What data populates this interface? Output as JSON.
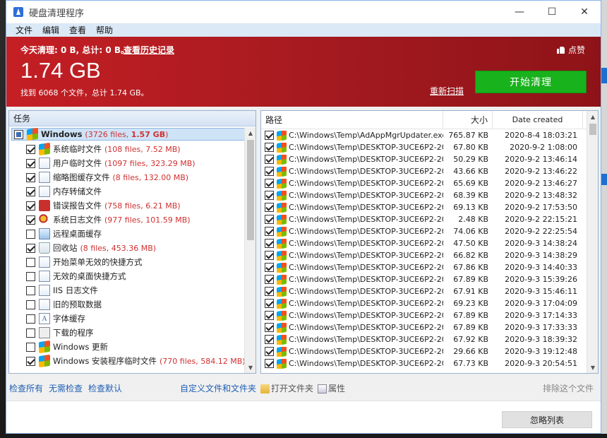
{
  "window": {
    "title": "硬盘清理程序",
    "controls": [
      "—",
      "☐",
      "✕"
    ]
  },
  "menu": [
    "文件",
    "编辑",
    "查看",
    "帮助"
  ],
  "header": {
    "today_summary": "今天清理: 0 B, 总计: 0 B。",
    "history_link": "查看历史记录",
    "like_label": "点赞",
    "total_size": "1.74 GB",
    "found_text": "找到 6068 个文件，总计 1.74 GB。",
    "rescan_link": "重新扫描",
    "start_button": "开始清理"
  },
  "tasks": {
    "header": "任务",
    "root": {
      "label": "Windows",
      "count": "3726 files",
      "size": "1.57 GB"
    },
    "items": [
      {
        "label": "系统临时文件",
        "stats": "(108 files, 7.52 MB)",
        "checked": true,
        "icon": "windows-icon"
      },
      {
        "label": "用户临时文件",
        "stats": "(1097 files, 323.29 MB)",
        "checked": true,
        "icon": "document-icon"
      },
      {
        "label": "缩略图缓存文件",
        "stats": "(8 files, 132.00 MB)",
        "checked": true,
        "icon": "document-icon"
      },
      {
        "label": "内存转储文件",
        "stats": "",
        "checked": true,
        "icon": "document-icon"
      },
      {
        "label": "错误报告文件",
        "stats": "(758 files, 6.21 MB)",
        "checked": true,
        "icon": "error-report-icon"
      },
      {
        "label": "系统日志文件",
        "stats": "(977 files, 101.59 MB)",
        "checked": true,
        "icon": "tools-icon"
      },
      {
        "label": "远程桌面缓存",
        "stats": "",
        "checked": false,
        "icon": "remote-desktop-icon"
      },
      {
        "label": "回收站",
        "stats": "(8 files, 453.36 MB)",
        "checked": true,
        "icon": "recycle-bin-icon"
      },
      {
        "label": "开始菜单无效的快捷方式",
        "stats": "",
        "checked": false,
        "icon": "shortcut-icon"
      },
      {
        "label": "无效的桌面快捷方式",
        "stats": "",
        "checked": false,
        "icon": "shortcut-icon"
      },
      {
        "label": "IIS 日志文件",
        "stats": "",
        "checked": false,
        "icon": "document-icon"
      },
      {
        "label": "旧的预取数据",
        "stats": "",
        "checked": false,
        "icon": "document-icon"
      },
      {
        "label": "字体缓存",
        "stats": "",
        "checked": false,
        "icon": "font-icon"
      },
      {
        "label": "下载的程序",
        "stats": "",
        "checked": false,
        "icon": "box-icon"
      },
      {
        "label": "Windows 更新",
        "stats": "",
        "checked": false,
        "icon": "windows-icon"
      },
      {
        "label": "Windows 安装程序临时文件",
        "stats": "(770 files, 584.12 MB)",
        "checked": true,
        "icon": "windows-icon"
      }
    ]
  },
  "files": {
    "columns": {
      "path": "路径",
      "size": "大小",
      "date": "Date created"
    },
    "rows": [
      {
        "path": "C:\\Windows\\Temp\\AdAppMgrUpdater.exe",
        "size": "765.87 KB",
        "date": "2020-8-4 18:03:21"
      },
      {
        "path": "C:\\Windows\\Temp\\DESKTOP-3UCE6P2-20...",
        "size": "67.80 KB",
        "date": "2020-9-2 1:08:00"
      },
      {
        "path": "C:\\Windows\\Temp\\DESKTOP-3UCE6P2-20...",
        "size": "50.29 KB",
        "date": "2020-9-2 13:46:14"
      },
      {
        "path": "C:\\Windows\\Temp\\DESKTOP-3UCE6P2-20...",
        "size": "43.66 KB",
        "date": "2020-9-2 13:46:22"
      },
      {
        "path": "C:\\Windows\\Temp\\DESKTOP-3UCE6P2-20...",
        "size": "65.69 KB",
        "date": "2020-9-2 13:46:27"
      },
      {
        "path": "C:\\Windows\\Temp\\DESKTOP-3UCE6P2-20...",
        "size": "68.39 KB",
        "date": "2020-9-2 13:48:32"
      },
      {
        "path": "C:\\Windows\\Temp\\DESKTOP-3UCE6P2-20...",
        "size": "69.13 KB",
        "date": "2020-9-2 17:53:50"
      },
      {
        "path": "C:\\Windows\\Temp\\DESKTOP-3UCE6P2-20...",
        "size": "2.48 KB",
        "date": "2020-9-2 22:15:21"
      },
      {
        "path": "C:\\Windows\\Temp\\DESKTOP-3UCE6P2-20...",
        "size": "74.06 KB",
        "date": "2020-9-2 22:25:54"
      },
      {
        "path": "C:\\Windows\\Temp\\DESKTOP-3UCE6P2-20...",
        "size": "47.50 KB",
        "date": "2020-9-3 14:38:24"
      },
      {
        "path": "C:\\Windows\\Temp\\DESKTOP-3UCE6P2-20...",
        "size": "66.82 KB",
        "date": "2020-9-3 14:38:29"
      },
      {
        "path": "C:\\Windows\\Temp\\DESKTOP-3UCE6P2-20...",
        "size": "67.86 KB",
        "date": "2020-9-3 14:40:33"
      },
      {
        "path": "C:\\Windows\\Temp\\DESKTOP-3UCE6P2-20...",
        "size": "67.89 KB",
        "date": "2020-9-3 15:39:26"
      },
      {
        "path": "C:\\Windows\\Temp\\DESKTOP-3UCE6P2-20...",
        "size": "67.91 KB",
        "date": "2020-9-3 15:46:11"
      },
      {
        "path": "C:\\Windows\\Temp\\DESKTOP-3UCE6P2-20...",
        "size": "69.23 KB",
        "date": "2020-9-3 17:04:09"
      },
      {
        "path": "C:\\Windows\\Temp\\DESKTOP-3UCE6P2-20...",
        "size": "67.89 KB",
        "date": "2020-9-3 17:14:33"
      },
      {
        "path": "C:\\Windows\\Temp\\DESKTOP-3UCE6P2-20...",
        "size": "67.89 KB",
        "date": "2020-9-3 17:33:33"
      },
      {
        "path": "C:\\Windows\\Temp\\DESKTOP-3UCE6P2-20...",
        "size": "67.92 KB",
        "date": "2020-9-3 18:39:32"
      },
      {
        "path": "C:\\Windows\\Temp\\DESKTOP-3UCE6P2-20...",
        "size": "29.66 KB",
        "date": "2020-9-3 19:12:48"
      },
      {
        "path": "C:\\Windows\\Temp\\DESKTOP-3UCE6P2-20...",
        "size": "67.73 KB",
        "date": "2020-9-3 20:54:51"
      }
    ]
  },
  "bottom": {
    "check_all": "检查所有",
    "check_none": "无需检查",
    "check_default": "检查默认",
    "custom_files": "自定义文件和文件夹",
    "open_folder": "打开文件夹",
    "properties": "属性",
    "exclude_file": "排除这个文件",
    "ignore_list": "忽略列表"
  },
  "colors": {
    "header_red": "#b71c21",
    "start_green": "#18b21c",
    "link_blue": "#1f5fb4",
    "stat_red": "#d03030"
  }
}
